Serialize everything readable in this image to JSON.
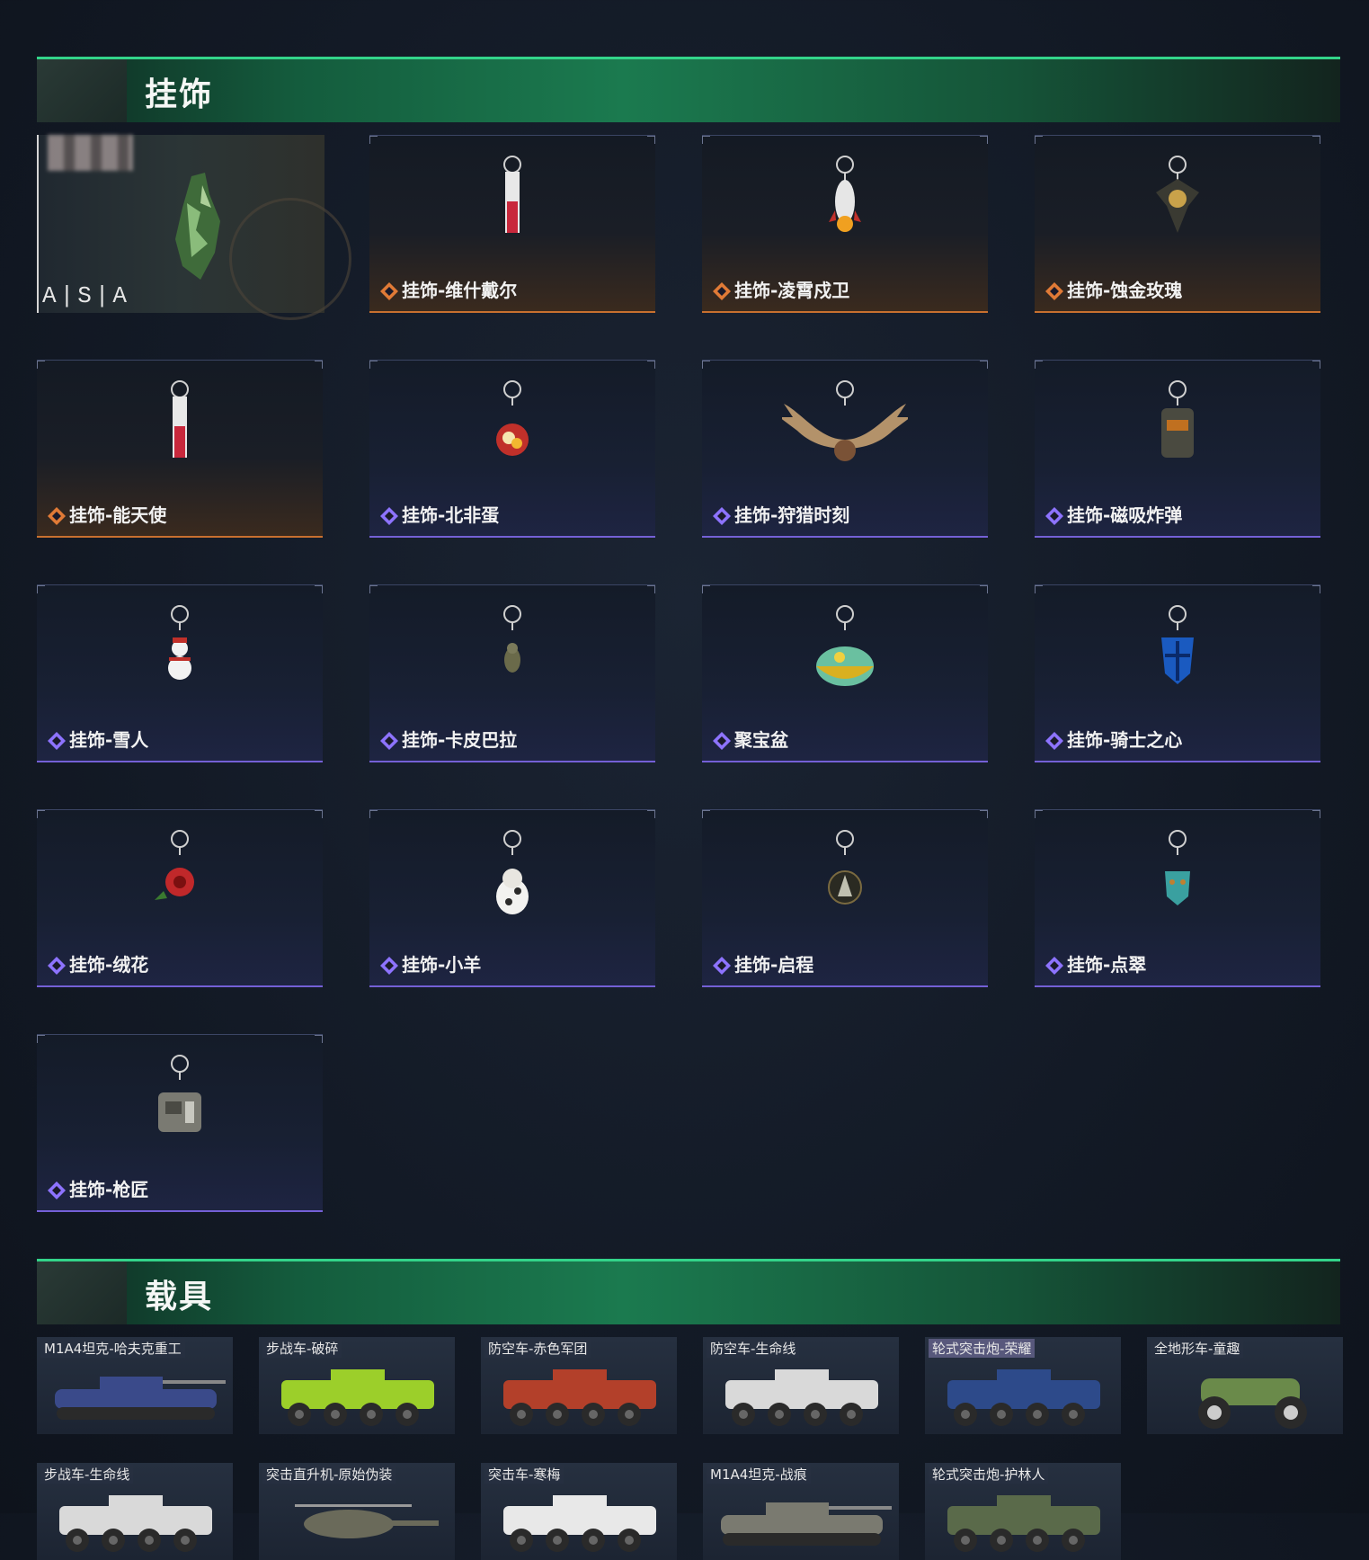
{
  "sections": {
    "charms_title": "挂饰",
    "vehicles_title": "载具"
  },
  "featured": {
    "watermark": "A|S|A"
  },
  "charms": [
    {
      "label": "挂饰-维什戴尔",
      "rarity": "gold",
      "icon": "tag-charm"
    },
    {
      "label": "挂饰-凌霄戍卫",
      "rarity": "gold",
      "icon": "rocket-charm"
    },
    {
      "label": "挂饰-蚀金玫瑰",
      "rarity": "gold",
      "icon": "rose-emblem-charm"
    },
    {
      "label": "挂饰-能天使",
      "rarity": "gold",
      "icon": "tag-charm"
    },
    {
      "label": "挂饰-北非蛋",
      "rarity": "purple",
      "icon": "pan-charm"
    },
    {
      "label": "挂饰-狩猎时刻",
      "rarity": "purple",
      "icon": "antler-charm"
    },
    {
      "label": "挂饰-磁吸炸弹",
      "rarity": "purple",
      "icon": "bomb-charm"
    },
    {
      "label": "挂饰-雪人",
      "rarity": "purple",
      "icon": "snowman-charm"
    },
    {
      "label": "挂饰-卡皮巴拉",
      "rarity": "purple",
      "icon": "capybara-charm"
    },
    {
      "label": "聚宝盆",
      "rarity": "purple",
      "icon": "treasure-bowl-charm"
    },
    {
      "label": "挂饰-骑士之心",
      "rarity": "purple",
      "icon": "knight-shield-charm"
    },
    {
      "label": "挂饰-绒花",
      "rarity": "purple",
      "icon": "flower-charm"
    },
    {
      "label": "挂饰-小羊",
      "rarity": "purple",
      "icon": "lamb-charm"
    },
    {
      "label": "挂饰-启程",
      "rarity": "purple",
      "icon": "medal-charm"
    },
    {
      "label": "挂饰-点翠",
      "rarity": "purple",
      "icon": "mask-charm"
    },
    {
      "label": "挂饰-枪匠",
      "rarity": "purple",
      "icon": "dogtag-charm"
    }
  ],
  "vehicles": [
    {
      "label": "M1A4坦克-哈夫克重工",
      "color": "#3a4a8a",
      "kind": "tank"
    },
    {
      "label": "步战车-破碎",
      "color": "#9ccf2a",
      "kind": "ifv"
    },
    {
      "label": "防空车-赤色军团",
      "color": "#b3402a",
      "kind": "ifv"
    },
    {
      "label": "防空车-生命线",
      "color": "#d9d9d9",
      "kind": "ifv"
    },
    {
      "label": "轮式突击炮-荣耀",
      "color": "#2d4a8a",
      "kind": "ifv"
    },
    {
      "label": "全地形车-童趣",
      "color": "#6a8a4a",
      "kind": "atv"
    },
    {
      "label": "步战车-生命线",
      "color": "#d9d9d9",
      "kind": "ifv"
    },
    {
      "label": "突击直升机-原始伪装",
      "color": "#6a6a5a",
      "kind": "heli"
    },
    {
      "label": "突击车-寒梅",
      "color": "#e8e8e8",
      "kind": "ifv"
    },
    {
      "label": "M1A4坦克-战痕",
      "color": "#7a7a70",
      "kind": "tank"
    },
    {
      "label": "轮式突击炮-护林人",
      "color": "#5a6a4a",
      "kind": "ifv"
    }
  ],
  "colors": {
    "gold": "#e07a36",
    "purple": "#8d73ff",
    "header_green": "#1b7a4f"
  }
}
